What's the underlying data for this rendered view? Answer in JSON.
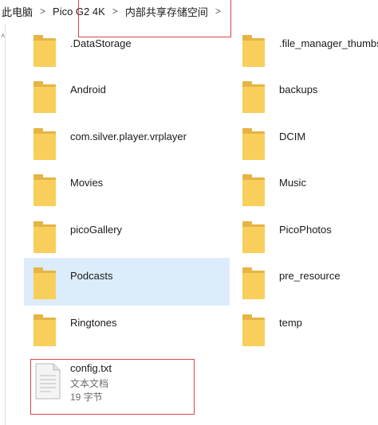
{
  "breadcrumb": [
    "此电脑",
    "Pico G2 4K",
    "内部共享存储空间"
  ],
  "folders_left": [
    ".DataStorage",
    "Android",
    "com.silver.player.vrplayer",
    "Movies",
    "picoGallery",
    "Podcasts",
    "Ringtones"
  ],
  "folders_right": [
    ".file_manager_thumbs",
    "backups",
    "DCIM",
    "Music",
    "PicoPhotos",
    "pre_resource",
    "temp"
  ],
  "selected_folder": "Podcasts",
  "file": {
    "name": "config.txt",
    "type": "文本文档",
    "size": "19 字节"
  },
  "colors": {
    "folder": "#f8cf5b",
    "selection": "#dcecfb",
    "highlight": "#e04444"
  }
}
